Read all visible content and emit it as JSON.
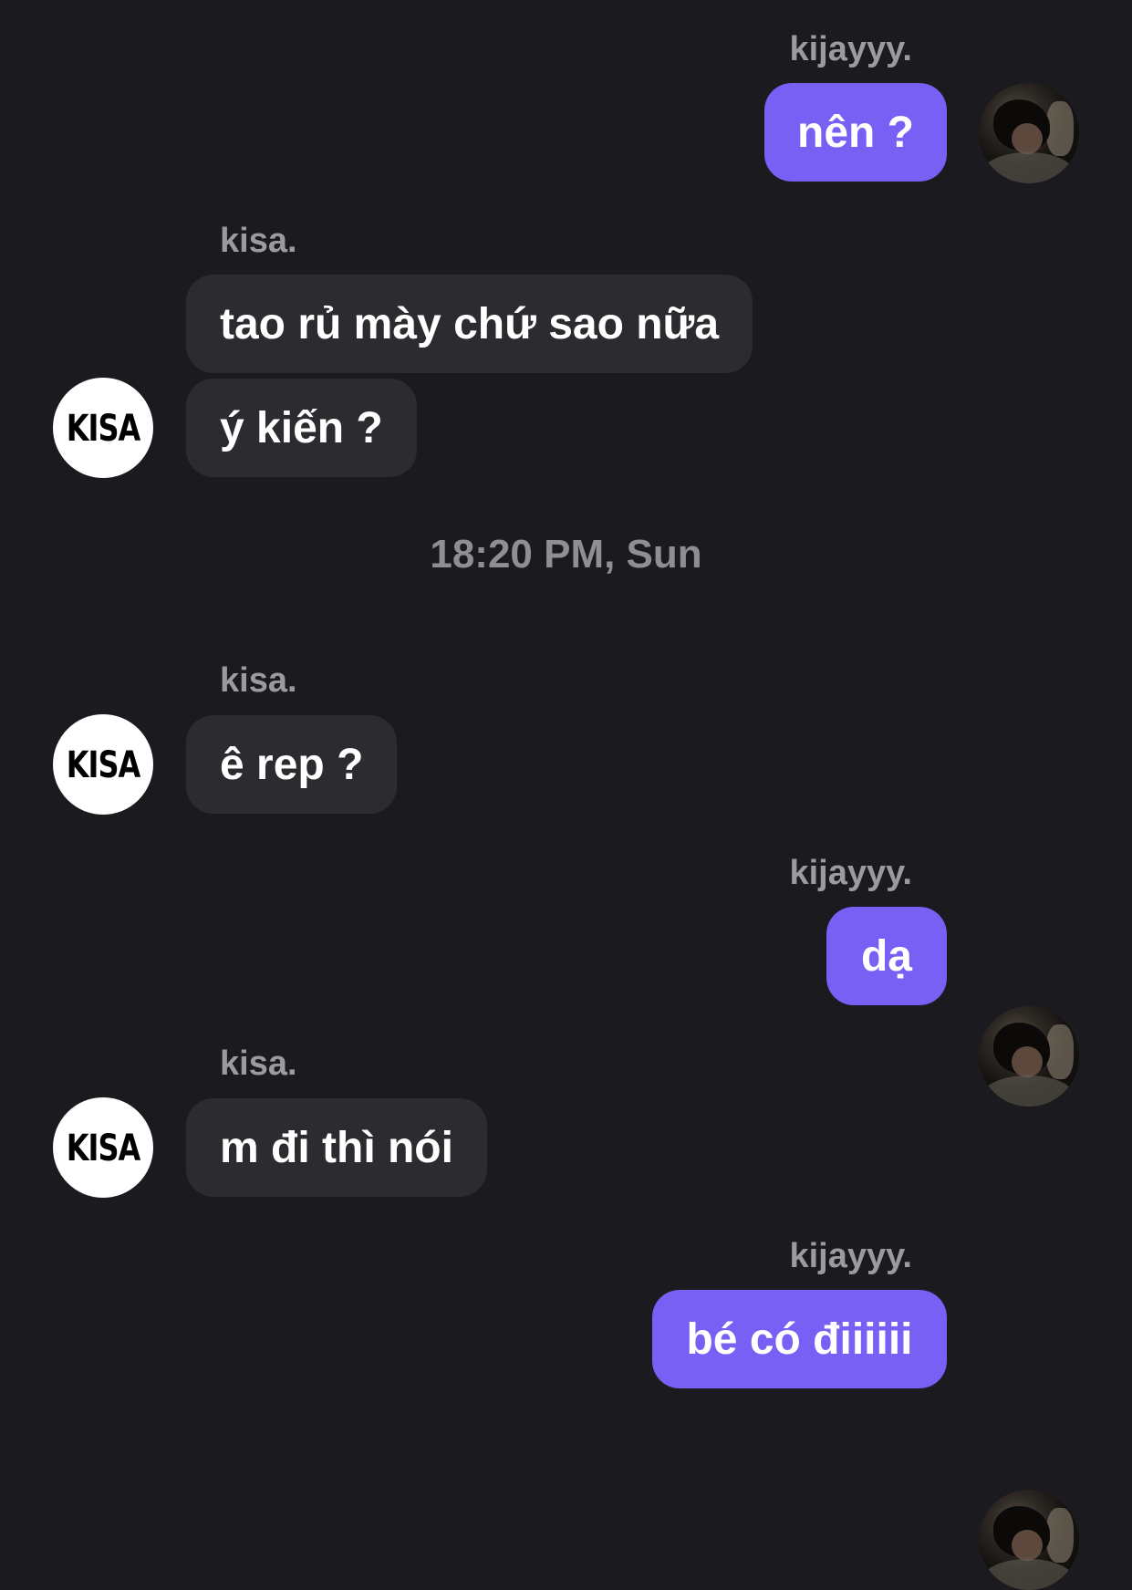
{
  "messages": [
    {
      "sender": "kijayyy.",
      "text": "nên ?"
    },
    {
      "sender": "kisa.",
      "text": "tao rủ mày chứ sao nữa"
    },
    {
      "text": "ý kiến ?"
    },
    {
      "timestamp": "18:20 PM, Sun"
    },
    {
      "sender": "kisa.",
      "text": "ê rep ?"
    },
    {
      "sender": "kijayyy.",
      "text": "dạ"
    },
    {
      "sender": "kisa.",
      "text": "m đi thì nói"
    },
    {
      "sender": "kijayyy.",
      "text": "bé có điiiiii"
    }
  ],
  "avatars": {
    "kisa_logo_text": "KISA"
  },
  "colors": {
    "background": "#1b1b1f",
    "incoming_bubble": "#2c2c30",
    "outgoing_bubble": "#7760f3",
    "sender_name": "#9a9aa0",
    "timestamp": "#8e8e93"
  }
}
